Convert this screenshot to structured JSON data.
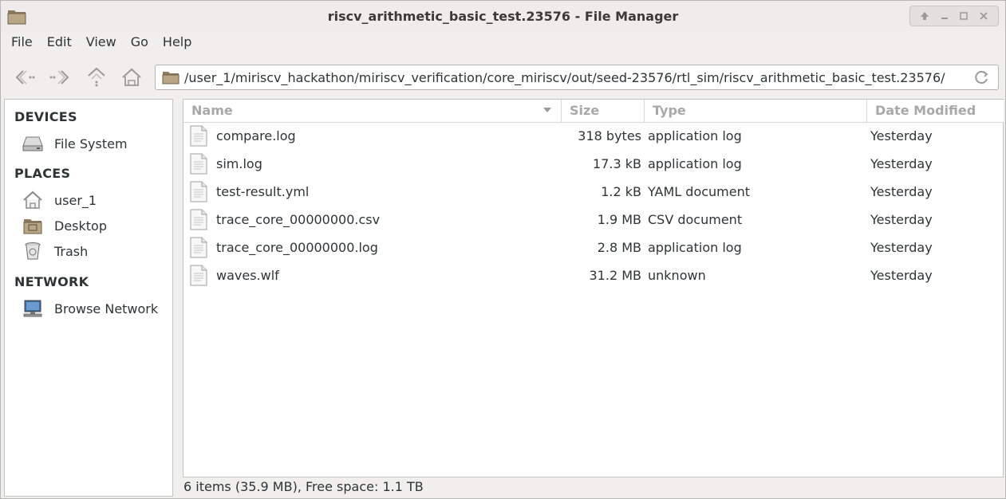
{
  "window": {
    "title": "riscv_arithmetic_basic_test.23576 - File Manager",
    "controls": [
      "up-arrow-icon",
      "minimize-icon",
      "maximize-icon",
      "close-icon"
    ]
  },
  "menu": {
    "items": [
      "File",
      "Edit",
      "View",
      "Go",
      "Help"
    ]
  },
  "toolbar": {
    "path": "/user_1/miriscv_hackathon/miriscv_verification/core_miriscv/out/seed-23576/rtl_sim/riscv_arithmetic_basic_test.23576/"
  },
  "sidebar": {
    "devices_header": "DEVICES",
    "devices": [
      {
        "label": "File System",
        "icon": "drive-icon"
      }
    ],
    "places_header": "PLACES",
    "places": [
      {
        "label": "user_1",
        "icon": "home-icon"
      },
      {
        "label": "Desktop",
        "icon": "desktop-folder-icon"
      },
      {
        "label": "Trash",
        "icon": "trash-icon"
      }
    ],
    "network_header": "NETWORK",
    "network": [
      {
        "label": "Browse Network",
        "icon": "network-icon"
      }
    ]
  },
  "columns": {
    "name": "Name",
    "size": "Size",
    "type": "Type",
    "date": "Date Modified"
  },
  "files": [
    {
      "name": "compare.log",
      "size": "318 bytes",
      "type": "application log",
      "date": "Yesterday"
    },
    {
      "name": "sim.log",
      "size": "17.3 kB",
      "type": "application log",
      "date": "Yesterday"
    },
    {
      "name": "test-result.yml",
      "size": "1.2 kB",
      "type": "YAML document",
      "date": "Yesterday"
    },
    {
      "name": "trace_core_00000000.csv",
      "size": "1.9 MB",
      "type": "CSV document",
      "date": "Yesterday"
    },
    {
      "name": "trace_core_00000000.log",
      "size": "2.8 MB",
      "type": "application log",
      "date": "Yesterday"
    },
    {
      "name": "waves.wlf",
      "size": "31.2 MB",
      "type": "unknown",
      "date": "Yesterday"
    }
  ],
  "status": {
    "text": "6 items (35.9 MB), Free space: 1.1 TB"
  },
  "colors": {
    "window_bg": "#f0efee",
    "header_text": "#a8a8a8",
    "folder": "#a89470"
  }
}
